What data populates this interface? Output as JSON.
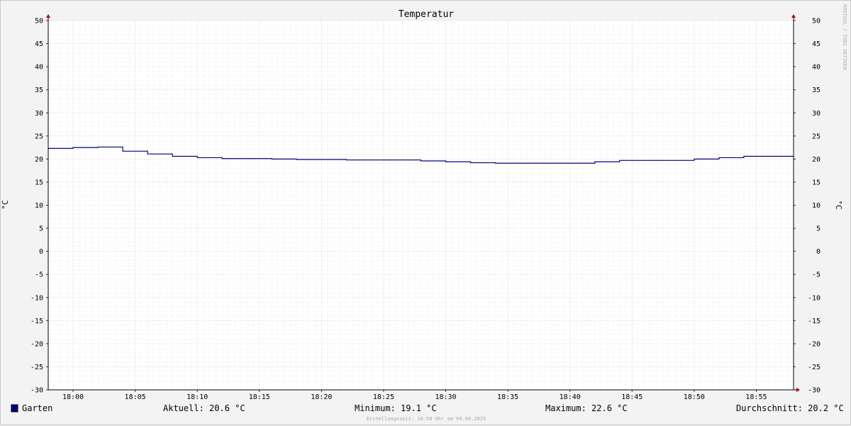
{
  "chart_data": {
    "type": "line",
    "title": "Temperatur",
    "ylabel": "°C",
    "ylabel_right": "°C",
    "ylim": [
      -30,
      50
    ],
    "y_ticks": [
      50,
      45,
      40,
      35,
      30,
      25,
      20,
      15,
      10,
      5,
      0,
      -5,
      -10,
      -15,
      -20,
      -25,
      -30
    ],
    "x_tick_labels": [
      "18:00",
      "18:05",
      "18:10",
      "18:15",
      "18:20",
      "18:25",
      "18:30",
      "18:35",
      "18:40",
      "18:45",
      "18:50",
      "18:55"
    ],
    "x_range": [
      "17:58",
      "18:58"
    ],
    "grid": true,
    "series": [
      {
        "name": "Garten",
        "color": "#000080",
        "step": true,
        "x": [
          "17:58",
          "18:00",
          "18:02",
          "18:04",
          "18:06",
          "18:08",
          "18:10",
          "18:12",
          "18:14",
          "18:16",
          "18:18",
          "18:20",
          "18:22",
          "18:24",
          "18:26",
          "18:28",
          "18:30",
          "18:32",
          "18:34",
          "18:36",
          "18:38",
          "18:40",
          "18:42",
          "18:44",
          "18:46",
          "18:48",
          "18:50",
          "18:52",
          "18:54",
          "18:56",
          "18:58"
        ],
        "values": [
          22.3,
          22.5,
          22.6,
          21.7,
          21.1,
          20.6,
          20.3,
          20.1,
          20.1,
          20.0,
          19.9,
          19.9,
          19.8,
          19.8,
          19.8,
          19.6,
          19.4,
          19.2,
          19.1,
          19.1,
          19.1,
          19.1,
          19.4,
          19.7,
          19.7,
          19.7,
          20.0,
          20.3,
          20.6,
          20.6,
          20.6
        ]
      }
    ]
  },
  "legend": {
    "label": "Garten",
    "color": "#000080"
  },
  "stats": {
    "current": "Aktuell: 20.6 °C",
    "minimum": "Minimum: 19.1 °C",
    "maximum": "Maximum: 22.6 °C",
    "average": "Durchschnitt: 20.2 °C"
  },
  "created": "Erstellungszeit: 18:58 Uhr am 09.06.2025",
  "watermark": "RRDTOOL / TOBI OETIKER"
}
